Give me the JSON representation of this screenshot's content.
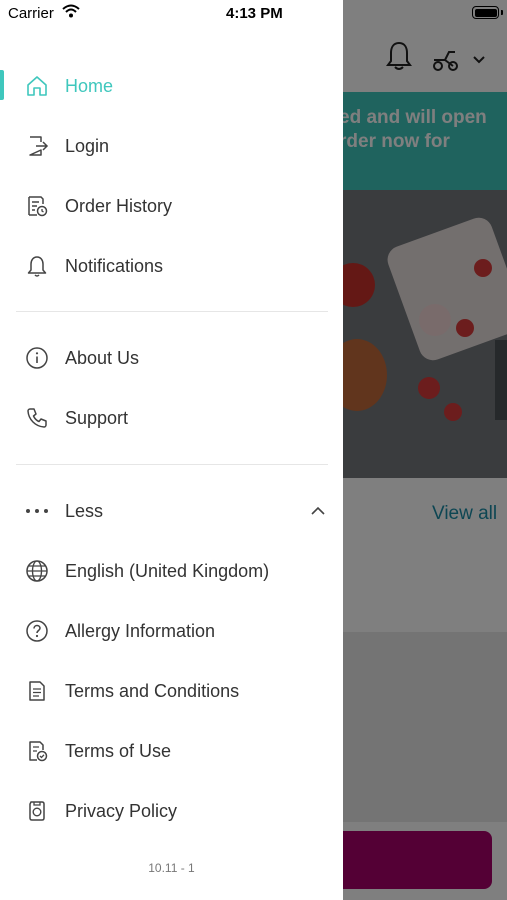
{
  "status_bar": {
    "carrier": "Carrier",
    "time": "4:13 PM"
  },
  "background": {
    "banner_line1": "ed and will open",
    "banner_line2": "rder now for",
    "view_all": "View all"
  },
  "menu": {
    "primary": [
      {
        "label": "Home",
        "icon": "home-icon",
        "active": true
      },
      {
        "label": "Login",
        "icon": "login-icon"
      },
      {
        "label": "Order History",
        "icon": "order-history-icon"
      },
      {
        "label": "Notifications",
        "icon": "bell-icon"
      }
    ],
    "secondary": [
      {
        "label": "About Us",
        "icon": "info-icon"
      },
      {
        "label": "Support",
        "icon": "phone-icon"
      }
    ],
    "more_toggle": {
      "label": "Less",
      "icon": "more-dots-icon"
    },
    "extra": [
      {
        "label": "English (United Kingdom)",
        "icon": "globe-icon"
      },
      {
        "label": "Allergy Information",
        "icon": "question-icon"
      },
      {
        "label": "Terms and Conditions",
        "icon": "document-icon"
      },
      {
        "label": "Terms of Use",
        "icon": "document-check-icon"
      },
      {
        "label": "Privacy Policy",
        "icon": "privacy-icon"
      }
    ]
  },
  "version": "10.11 - 1",
  "colors": {
    "accent": "#3fc7bd",
    "brand_cta": "#a8006a",
    "text": "#333333"
  }
}
